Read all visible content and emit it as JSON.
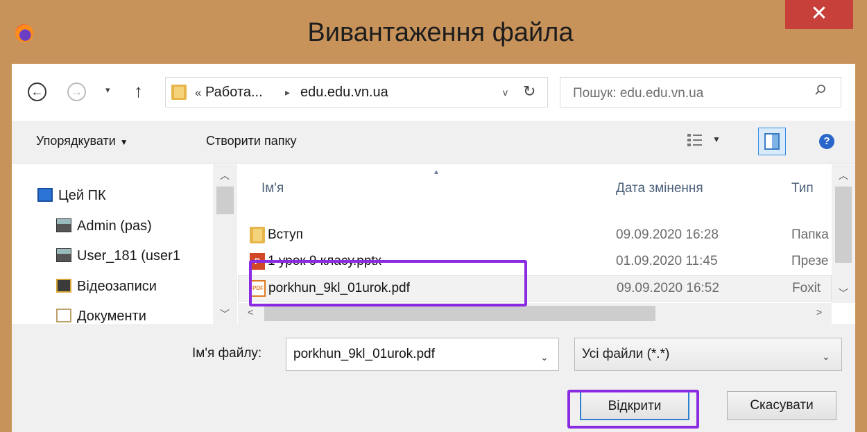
{
  "window": {
    "title": "Вивантаження файла",
    "close_glyph": "✕",
    "app_icon": "firefox-icon"
  },
  "address": {
    "more": "«",
    "crumbs": [
      "Работа...",
      "edu.edu.vn.ua"
    ],
    "separator": "▸",
    "dropdown_glyph": "v",
    "refresh_glyph": "↻"
  },
  "nav_buttons": {
    "back": "←",
    "forward": "→",
    "recent": "▾",
    "up": "↑"
  },
  "search": {
    "placeholder": "Пошук: edu.edu.vn.ua"
  },
  "toolbar": {
    "organize": "Упорядкувати",
    "organize_caret": "▼",
    "new_folder": "Створити папку",
    "view_caret": "▼",
    "help": "?"
  },
  "nav_pane": {
    "items": [
      {
        "label": "Цей ПК",
        "icon": "computer-icon"
      },
      {
        "label": "Admin (pas)",
        "icon": "network-drive-icon"
      },
      {
        "label": "User_181 (user1",
        "icon": "network-drive-icon"
      },
      {
        "label": "Відеозаписи",
        "icon": "video-folder-icon"
      },
      {
        "label": "Документи",
        "icon": "documents-folder-icon"
      }
    ]
  },
  "file_list": {
    "columns": [
      "Ім'я",
      "Дата змінення",
      "Тип"
    ],
    "rows": [
      {
        "name": "Вступ",
        "date": "09.09.2020 16:28",
        "type": "Папка",
        "icon": "folder-icon"
      },
      {
        "name": "1 урок 9 класу.pptx",
        "date": "01.09.2020 11:45",
        "type": "Презе",
        "icon": "powerpoint-file-icon"
      },
      {
        "name": "porkhun_9kl_01urok.pdf",
        "date": "09.09.2020 16:52",
        "type": "Foxit",
        "icon": "pdf-file-icon",
        "selected": true
      }
    ]
  },
  "bottom": {
    "filename_label": "Ім'я файлу:",
    "filename_value": "porkhun_9kl_01urok.pdf",
    "filter": "Усі файли (*.*)",
    "open_button": "Відкрити",
    "cancel_button": "Скасувати"
  },
  "colors": {
    "titlebar": "#c8935a",
    "close_button": "#c7403a",
    "highlight": "#8a2be2",
    "selection": "#f2f2f2"
  }
}
